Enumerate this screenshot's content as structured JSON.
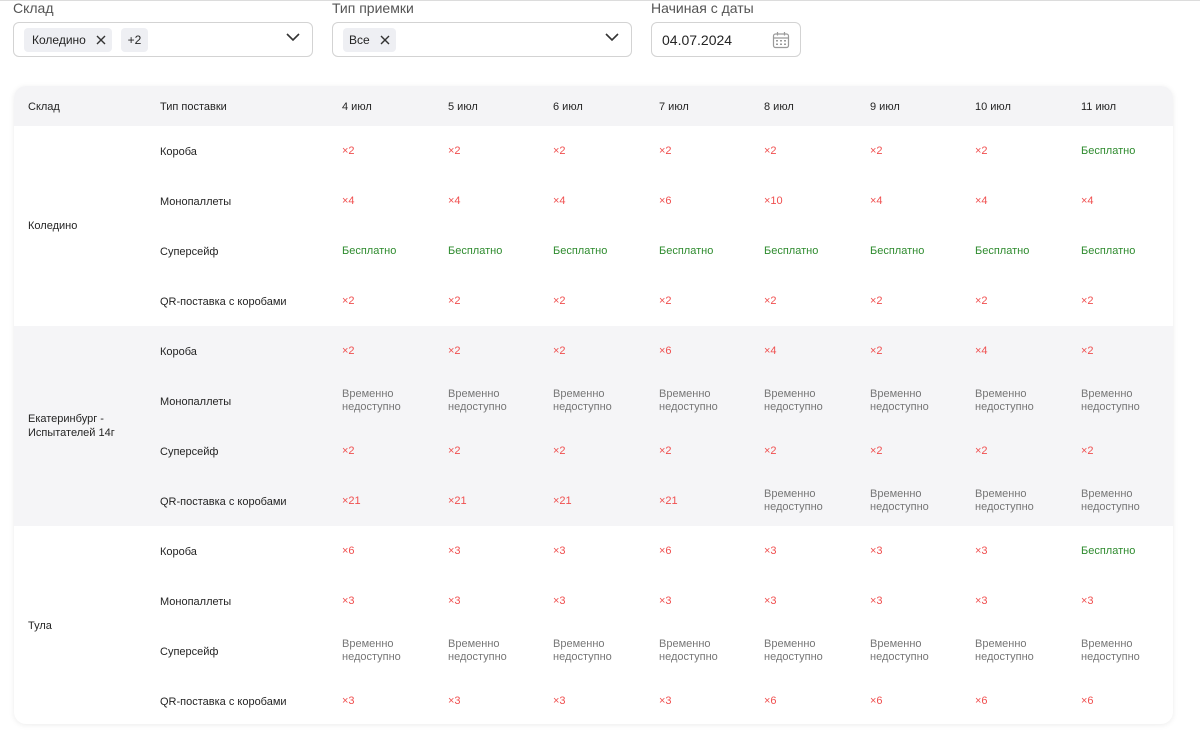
{
  "filters": {
    "warehouse": {
      "label": "Склад",
      "chip": "Коледино",
      "more": "+2"
    },
    "acceptance_type": {
      "label": "Тип приемки",
      "chip": "Все"
    },
    "start_date": {
      "label": "Начиная с даты",
      "value": "04.07.2024"
    }
  },
  "table": {
    "headers": {
      "warehouse": "Склад",
      "supply_type": "Тип поставки",
      "dates": [
        "4 июл",
        "5 июл",
        "6 июл",
        "7 июл",
        "8 июл",
        "9 июл",
        "10 июл",
        "11 июл"
      ]
    },
    "groups": [
      {
        "warehouse": "Коледино",
        "shaded": false,
        "rows": [
          {
            "type": "Короба",
            "cells": [
              "×2",
              "×2",
              "×2",
              "×2",
              "×2",
              "×2",
              "×2",
              "Бесплатно"
            ]
          },
          {
            "type": "Монопаллеты",
            "cells": [
              "×4",
              "×4",
              "×4",
              "×6",
              "×10",
              "×4",
              "×4",
              "×4"
            ]
          },
          {
            "type": "Суперсейф",
            "cells": [
              "Бесплатно",
              "Бесплатно",
              "Бесплатно",
              "Бесплатно",
              "Бесплатно",
              "Бесплатно",
              "Бесплатно",
              "Бесплатно"
            ]
          },
          {
            "type": "QR-поставка с коробами",
            "cells": [
              "×2",
              "×2",
              "×2",
              "×2",
              "×2",
              "×2",
              "×2",
              "×2"
            ]
          }
        ]
      },
      {
        "warehouse": "Екатеринбург - Испытателей 14г",
        "shaded": true,
        "rows": [
          {
            "type": "Короба",
            "cells": [
              "×2",
              "×2",
              "×2",
              "×6",
              "×4",
              "×2",
              "×4",
              "×2"
            ]
          },
          {
            "type": "Монопаллеты",
            "cells": [
              "Временно недоступно",
              "Временно недоступно",
              "Временно недоступно",
              "Временно недоступно",
              "Временно недоступно",
              "Временно недоступно",
              "Временно недоступно",
              "Временно недоступно"
            ]
          },
          {
            "type": "Суперсейф",
            "cells": [
              "×2",
              "×2",
              "×2",
              "×2",
              "×2",
              "×2",
              "×2",
              "×2"
            ]
          },
          {
            "type": "QR-поставка с коробами",
            "cells": [
              "×21",
              "×21",
              "×21",
              "×21",
              "Временно недоступно",
              "Временно недоступно",
              "Временно недоступно",
              "Временно недоступно"
            ]
          }
        ]
      },
      {
        "warehouse": "Тула",
        "shaded": false,
        "rows": [
          {
            "type": "Короба",
            "cells": [
              "×6",
              "×3",
              "×3",
              "×6",
              "×3",
              "×3",
              "×3",
              "Бесплатно"
            ]
          },
          {
            "type": "Монопаллеты",
            "cells": [
              "×3",
              "×3",
              "×3",
              "×3",
              "×3",
              "×3",
              "×3",
              "×3"
            ]
          },
          {
            "type": "Суперсейф",
            "cells": [
              "Временно недоступно",
              "Временно недоступно",
              "Временно недоступно",
              "Временно недоступно",
              "Временно недоступно",
              "Временно недоступно",
              "Временно недоступно",
              "Временно недоступно"
            ]
          },
          {
            "type": "QR-поставка с коробами",
            "cells": [
              "×3",
              "×3",
              "×3",
              "×3",
              "×6",
              "×6",
              "×6",
              "×6"
            ]
          }
        ]
      }
    ]
  },
  "colors": {
    "coefficient": "#f04f4f",
    "free": "#2e8b2e",
    "unavailable": "#777777",
    "header_bg": "#f4f4f6",
    "shaded_group_bg": "#f5f5f7"
  },
  "icons": [
    "close-icon",
    "chevron-down-icon",
    "calendar-icon"
  ]
}
